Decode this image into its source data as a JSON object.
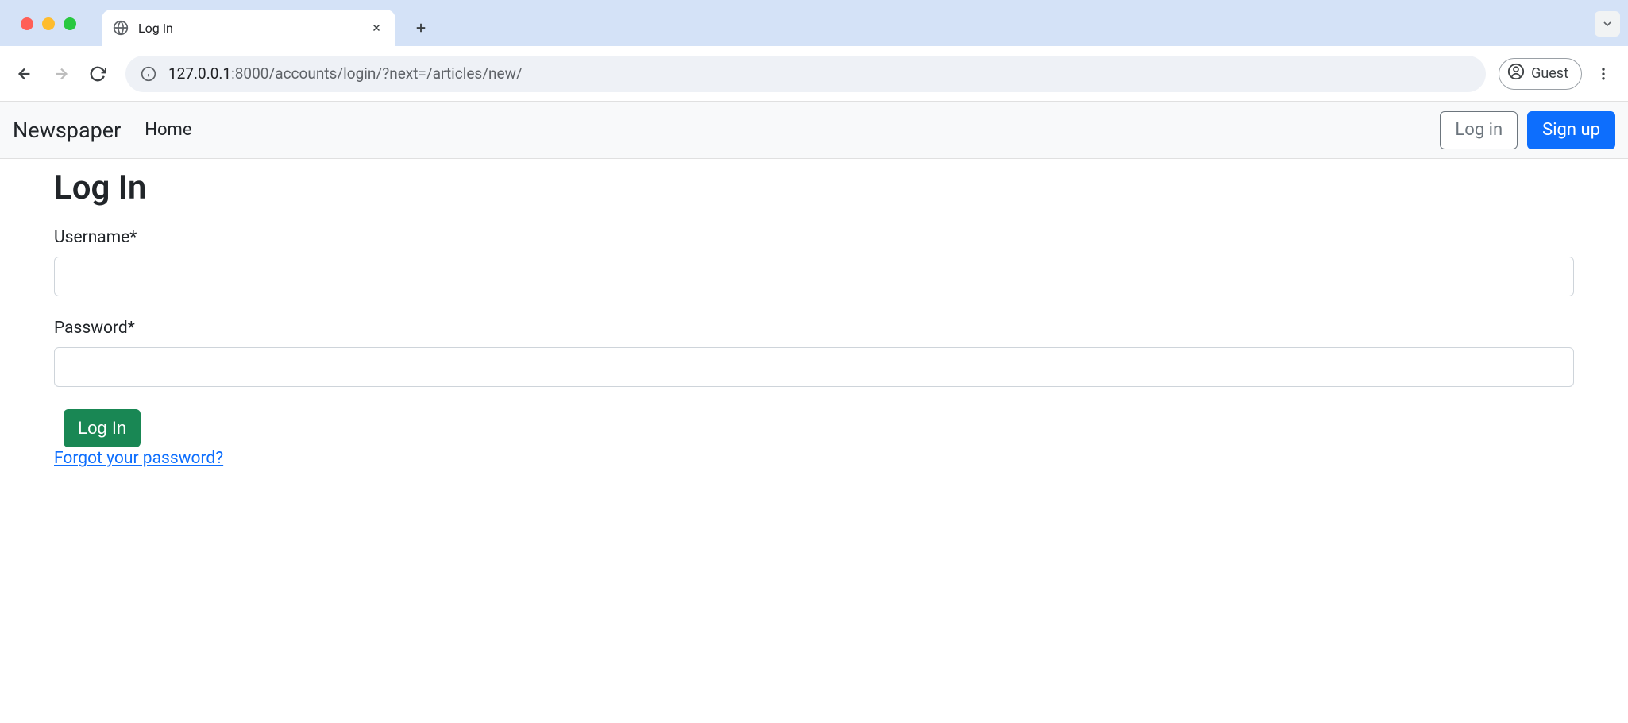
{
  "browser": {
    "tab_title": "Log In",
    "url_host": "127.0.0.1",
    "url_port": ":8000",
    "url_path": "/accounts/login/?next=/articles/new/",
    "guest_label": "Guest"
  },
  "navbar": {
    "brand": "Newspaper",
    "home": "Home",
    "login": "Log in",
    "signup": "Sign up"
  },
  "page": {
    "heading": "Log In",
    "username_label": "Username*",
    "password_label": "Password*",
    "submit_label": "Log In",
    "forgot_link": "Forgot your password?"
  }
}
